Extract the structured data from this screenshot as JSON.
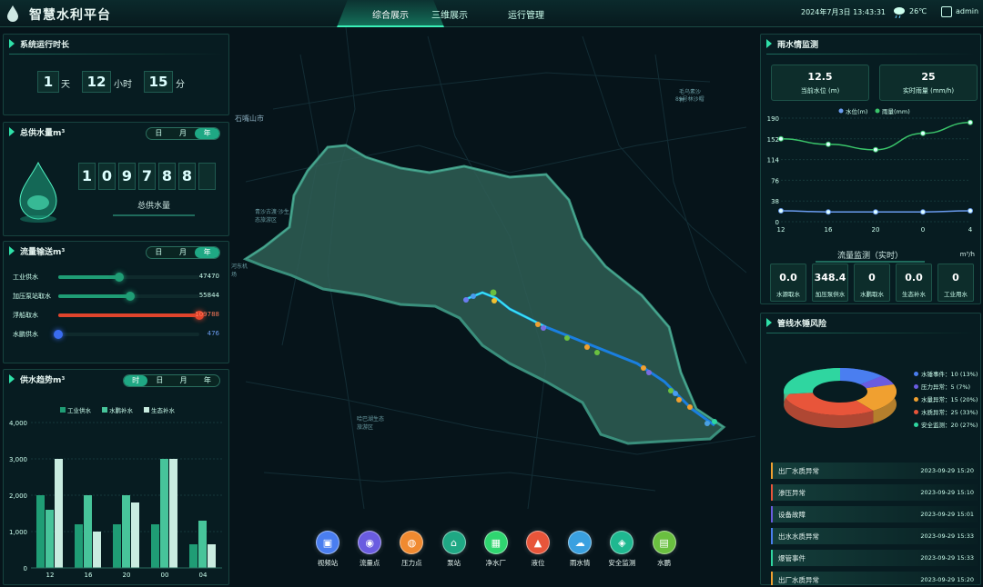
{
  "header": {
    "title": "智慧水利平台",
    "tabs": [
      "综合展示",
      "三维展示",
      "运行管理"
    ],
    "datetime": "2024年7月3日 13:43:31",
    "temperature": "26℃",
    "user": "admin"
  },
  "runtime": {
    "title": "系统运行时长",
    "days": "1",
    "day_unit": "天",
    "hours": "12",
    "hour_unit": "小时",
    "minutes": "15",
    "minute_unit": "分"
  },
  "supply": {
    "title": "总供水量m³",
    "periods": [
      "日",
      "月",
      "年"
    ],
    "active": "年",
    "digits": [
      "1",
      "0",
      "9",
      "7",
      "8",
      "8",
      ""
    ],
    "caption": "总供水量"
  },
  "flow": {
    "title": "流量输送m³",
    "periods": [
      "日",
      "月",
      "年"
    ],
    "active": "年",
    "items": [
      {
        "label": "工业供水",
        "value": "47470",
        "fraction": 0.43,
        "color": "#1f9d75"
      },
      {
        "label": "加压泵站取水",
        "value": "55844",
        "fraction": 0.51,
        "color": "#1f9d75"
      },
      {
        "label": "浮船取水",
        "value": "109788",
        "fraction": 1.0,
        "color": "#e0442c"
      },
      {
        "label": "水鹏供水",
        "value": "476",
        "fraction": 0.0,
        "color": "#3a6cf0"
      }
    ]
  },
  "trend": {
    "title": "供水趋势m³",
    "periods": [
      "时",
      "日",
      "月",
      "年"
    ],
    "active": "时"
  },
  "rain": {
    "title": "雨水情监测",
    "water_level": "12.5",
    "water_level_label": "当前水位 (m)",
    "rainfall": "25",
    "rainfall_label": "实时雨量 (mm/h)",
    "flow_title": "流量监测（实时）",
    "flow_unit": "m³/h",
    "flows": [
      {
        "v": "0.0",
        "l": "水源取水"
      },
      {
        "v": "348.4",
        "l": "加压泵供水"
      },
      {
        "v": "0",
        "l": "水鹏取水"
      },
      {
        "v": "0.0",
        "l": "生态补水"
      },
      {
        "v": "0",
        "l": "工业用水"
      }
    ]
  },
  "risk": {
    "title": "管线水锤风险",
    "legend": [
      "水锤事件：10 (13%)",
      "压力异常：5 (7%)",
      "水量异常：15 (20%)",
      "水质异常：25 (33%)",
      "安全监测：20 (27%)"
    ],
    "colors": [
      "#4a7ef0",
      "#6a5ce0",
      "#f0a030",
      "#e8553a",
      "#2fd6a0"
    ],
    "values": [
      10,
      5,
      15,
      25,
      20
    ],
    "alarms": [
      {
        "t": "出厂水质异常",
        "d": "2023-09-29 15:20"
      },
      {
        "t": "渗压异常",
        "d": "2023-09-29 15:10"
      },
      {
        "t": "设备故障",
        "d": "2023-09-29 15:01"
      },
      {
        "t": "出水水质异常",
        "d": "2023-09-29 15:33"
      },
      {
        "t": "爆管事件",
        "d": "2023-09-29 15:33"
      },
      {
        "t": "出厂水质异常",
        "d": "2023-09-29 15:20"
      }
    ]
  },
  "map_menu": [
    {
      "l": "视频站",
      "c": "#4a7ef0"
    },
    {
      "l": "流量点",
      "c": "#6a5ce0"
    },
    {
      "l": "压力点",
      "c": "#f08a30"
    },
    {
      "l": "泵站",
      "c": "#1fa884"
    },
    {
      "l": "净水厂",
      "c": "#2fd670"
    },
    {
      "l": "液位",
      "c": "#e8553a"
    },
    {
      "l": "雨水情",
      "c": "#3aa0e0"
    },
    {
      "l": "安全监测",
      "c": "#1fb890"
    },
    {
      "l": "水鹏",
      "c": "#6ac040"
    }
  ],
  "map_labels": [
    "石嘴山市",
    "河东机场",
    "青沙古渡·沙生态旅游区",
    "哈巴湖生态旅游区",
    "毛乌素沙林",
    "89号林沙帽"
  ],
  "chart_data": [
    {
      "type": "bar",
      "title": "供水趋势m³",
      "categories": [
        "12",
        "16",
        "20",
        "00",
        "04"
      ],
      "ylim": [
        0,
        4000
      ],
      "yticks": [
        "0",
        "1,000",
        "2,000",
        "3,000",
        "4,000"
      ],
      "series": [
        {
          "name": "工业供水",
          "values": [
            2000,
            1200,
            1200,
            1200,
            650
          ],
          "color": "#1f9d75"
        },
        {
          "name": "水鹏补水",
          "values": [
            1600,
            2000,
            2000,
            3000,
            1300
          ],
          "color": "#47c49a"
        },
        {
          "name": "生态补水",
          "values": [
            3000,
            1000,
            1800,
            3000,
            650
          ],
          "color": "#c9ece0"
        }
      ]
    },
    {
      "type": "line",
      "title": "雨水情监测",
      "x": [
        "12",
        "16",
        "20",
        "0",
        "4"
      ],
      "ylim": [
        0,
        190
      ],
      "yticks": [
        "0",
        "38",
        "76",
        "114",
        "152",
        "190"
      ],
      "series": [
        {
          "name": "水位(m)",
          "values": [
            20,
            18,
            18,
            18,
            20
          ],
          "color": "#6a9cf0"
        },
        {
          "name": "雨量(mm)",
          "values": [
            152,
            142,
            132,
            162,
            182
          ],
          "color": "#3ac46a"
        }
      ]
    }
  ]
}
